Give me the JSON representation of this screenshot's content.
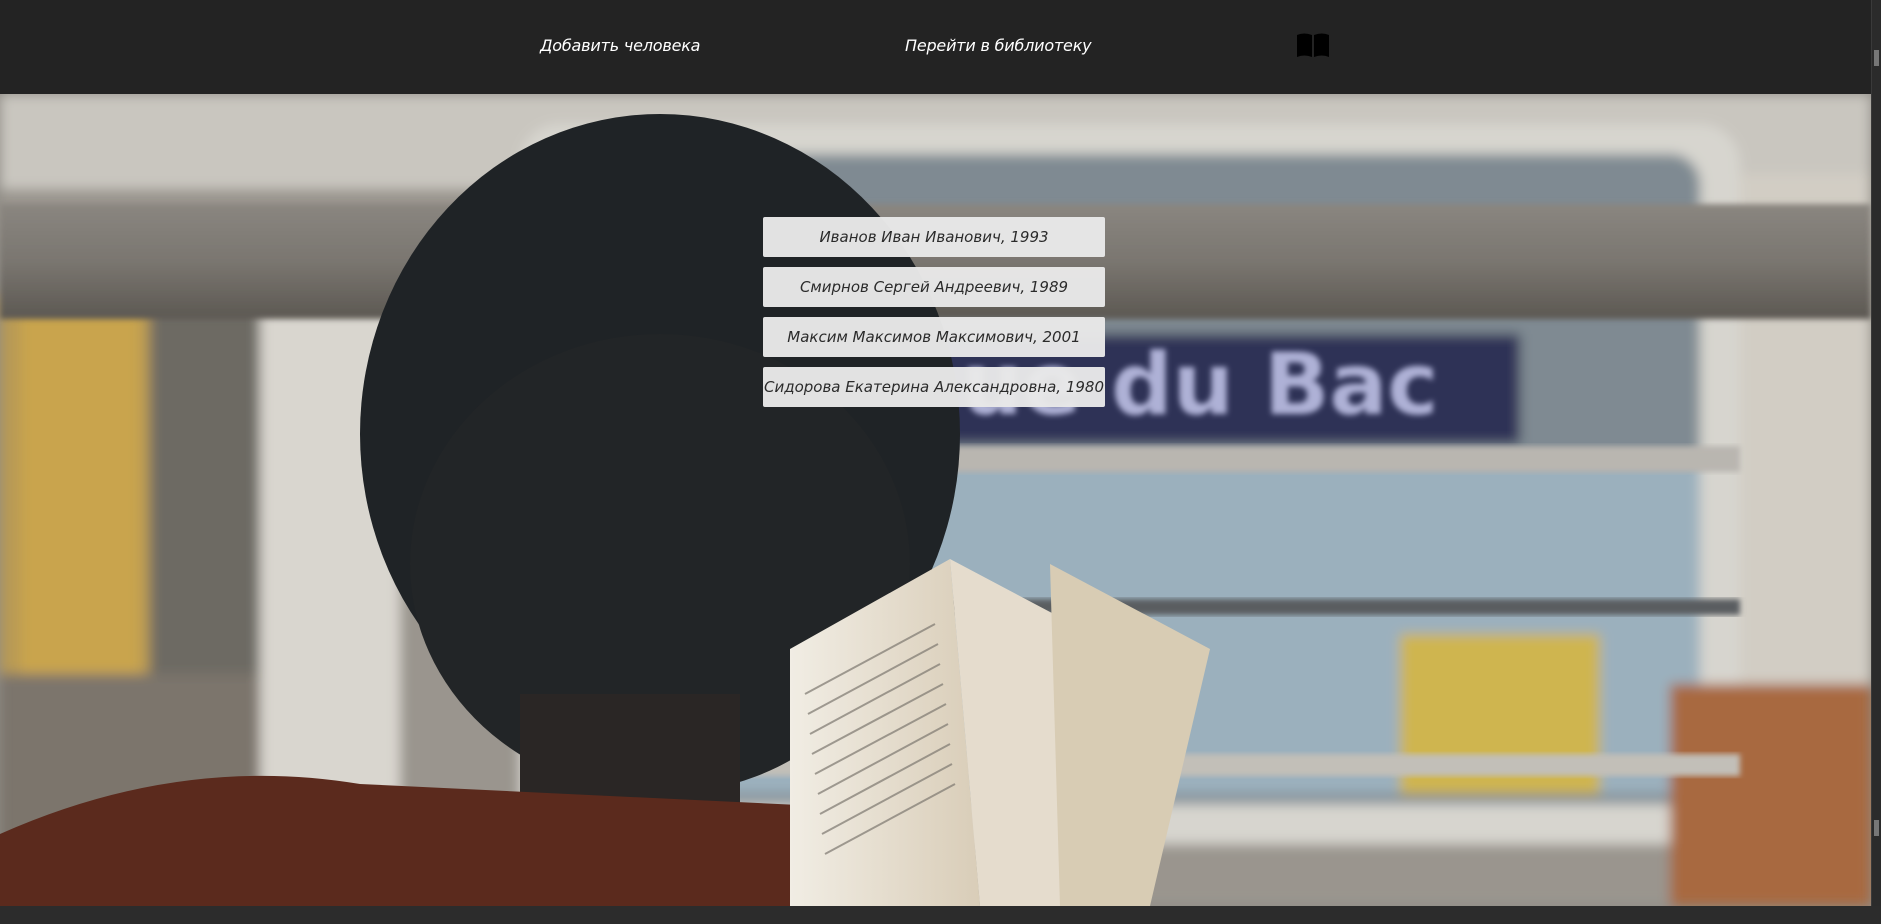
{
  "nav": {
    "add_person": "Добавить человека",
    "go_library": "Перейти в библиотеку",
    "book_icon": "open-book-icon"
  },
  "people": [
    "Иванов Иван Иванович, 1993",
    "Смирнов Сергей Андреевич, 1989",
    "Максим Максимов Максимович, 2001",
    "Сидорова Екатерина Александровна, 1980"
  ],
  "background": {
    "sign_text": "ue du Bac"
  },
  "colors": {
    "navbar": "#232323",
    "nav_text": "#ffffff",
    "list_item_bg": "#e8e8e8",
    "list_item_text": "#2b2b2b"
  }
}
